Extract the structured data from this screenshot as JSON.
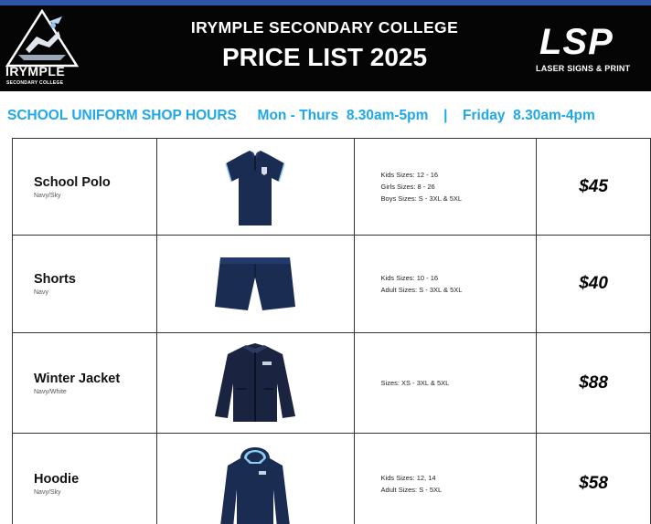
{
  "header": {
    "school_logo_text": "IRYMPLE",
    "school_logo_sub": "SECONDARY COLLEGE",
    "title_line1": "IRYMPLE SECONDARY COLLEGE",
    "title_line2": "PRICE LIST 2025",
    "sponsor_logo": "LSP",
    "sponsor_name": "LASER SIGNS & PRINT"
  },
  "hours": {
    "label": "SCHOOL UNIFORM SHOP HOURS",
    "weekday": "Mon - Thurs  8.30am-5pm",
    "separator": "|",
    "friday": "Friday  8.30am-4pm"
  },
  "items": [
    {
      "name": "School Polo",
      "color": "Navy/Sky",
      "image_icon": "polo-shirt-icon",
      "sizes": [
        "Kids Sizes: 12 - 16",
        "Girls Sizes: 8 - 26",
        "Boys Sizes: S - 3XL & 5XL"
      ],
      "price": "$45"
    },
    {
      "name": "Shorts",
      "color": "Navy",
      "image_icon": "shorts-icon",
      "sizes": [
        "Kids Sizes: 10 - 16",
        "Adult Sizes: S - 3XL & 5XL"
      ],
      "price": "$40"
    },
    {
      "name": "Winter Jacket",
      "color": "Navy/White",
      "image_icon": "jacket-icon",
      "sizes": [
        "Sizes: XS - 3XL & 5XL"
      ],
      "price": "$88"
    },
    {
      "name": "Hoodie",
      "color": "Navy/Sky",
      "image_icon": "hoodie-icon",
      "sizes": [
        "Kids Sizes: 12, 14",
        "Adult Sizes: S - 5XL"
      ],
      "price": "$58"
    }
  ],
  "colors": {
    "frame": "#2f55a9",
    "header_bg": "#050505",
    "hours_text": "#1ea8e8",
    "garment_navy": "#1b2c52"
  }
}
